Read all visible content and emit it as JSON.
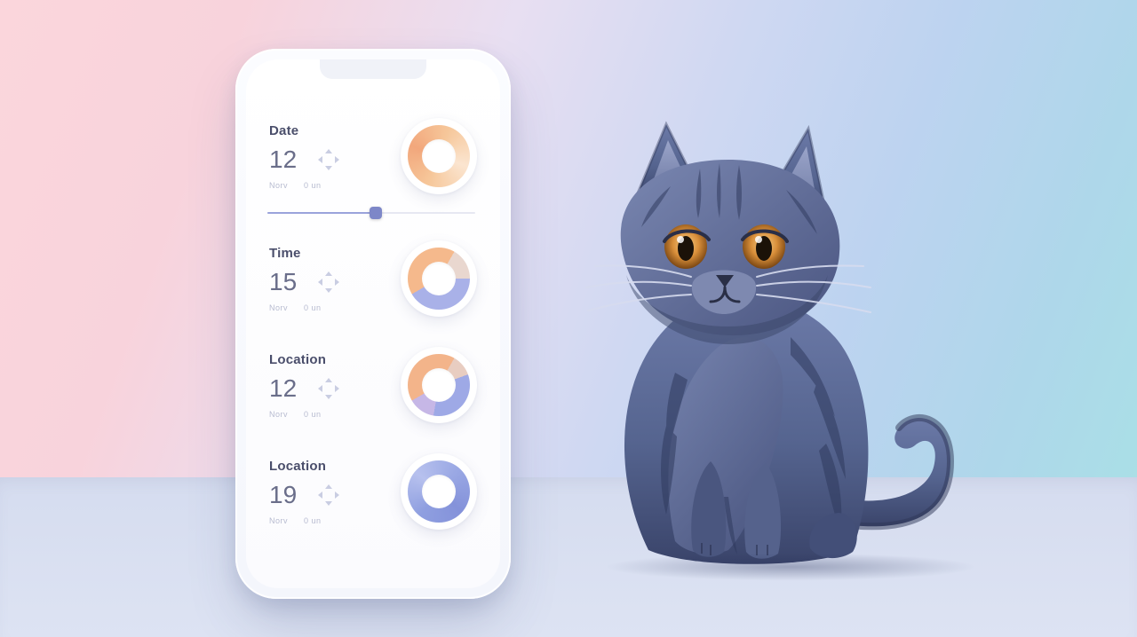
{
  "cards": [
    {
      "title": "Date",
      "value": "12",
      "sub1": "Norv",
      "sub2": "0 un"
    },
    {
      "title": "Time",
      "value": "15",
      "sub1": "Norv",
      "sub2": "0 un"
    },
    {
      "title": "Location",
      "value": "12",
      "sub1": "Norv",
      "sub2": "0 un"
    },
    {
      "title": "Location",
      "value": "19",
      "sub1": "Norv",
      "sub2": "0 un"
    }
  ],
  "slider": {
    "percent": 52
  }
}
